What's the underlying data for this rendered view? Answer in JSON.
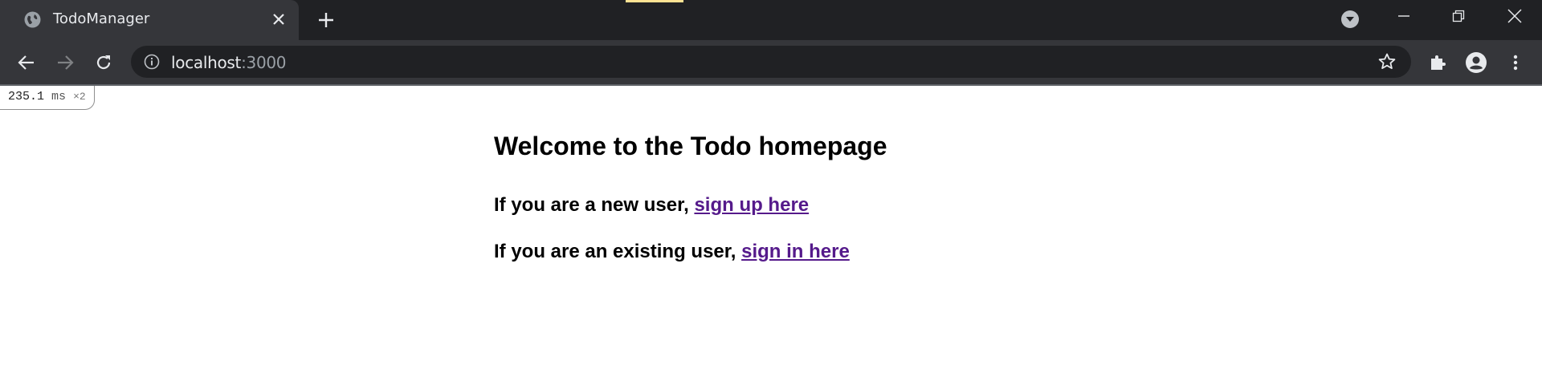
{
  "browser": {
    "tab": {
      "title": "TodoManager",
      "icon": "globe-icon"
    },
    "address": {
      "host": "localhost",
      "port": ":3000"
    }
  },
  "timing_badge": {
    "value": "235.1",
    "unit": "ms",
    "multiplier": "×2"
  },
  "page": {
    "heading": "Welcome to the Todo homepage",
    "new_user_text": "If you are a new user, ",
    "new_user_link": "sign up here",
    "existing_user_text": "If you are an existing user, ",
    "existing_user_link": "sign in here"
  },
  "colors": {
    "tabstrip": "#202124",
    "toolbar": "#35363a",
    "link_visited": "#551a8b"
  }
}
